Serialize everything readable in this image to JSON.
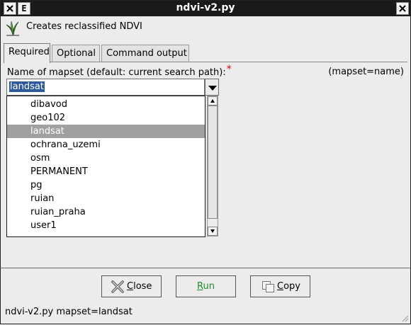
{
  "window": {
    "title": "ndvi-v2.py",
    "menu_button_label": "E"
  },
  "description": "Creates reclassified NDVI",
  "tabs": [
    {
      "label": "Required"
    },
    {
      "label": "Optional"
    },
    {
      "label": "Command output"
    }
  ],
  "field": {
    "label": "Name of mapset (default: current search path):",
    "required_marker": "*",
    "hint": "(mapset=name)",
    "value": "landsat"
  },
  "dropdown": {
    "items": [
      "dibavod",
      "geo102",
      "landsat",
      "ochrana_uzemi",
      "osm",
      "PERMANENT",
      "pg",
      "ruian",
      "ruian_praha",
      "user1"
    ],
    "selected_item": "landsat"
  },
  "buttons": {
    "close_underline": "C",
    "close_rest": "lose",
    "run_underline": "R",
    "run_rest": "un",
    "copy_underline": "C",
    "copy_rest": "opy"
  },
  "status": "ndvi-v2.py mapset=landsat",
  "colors": {
    "selection": "#2e5a9a",
    "list_selected": "#a0a0a0",
    "required": "#ee0000",
    "run_text": "#1e8a2b"
  }
}
